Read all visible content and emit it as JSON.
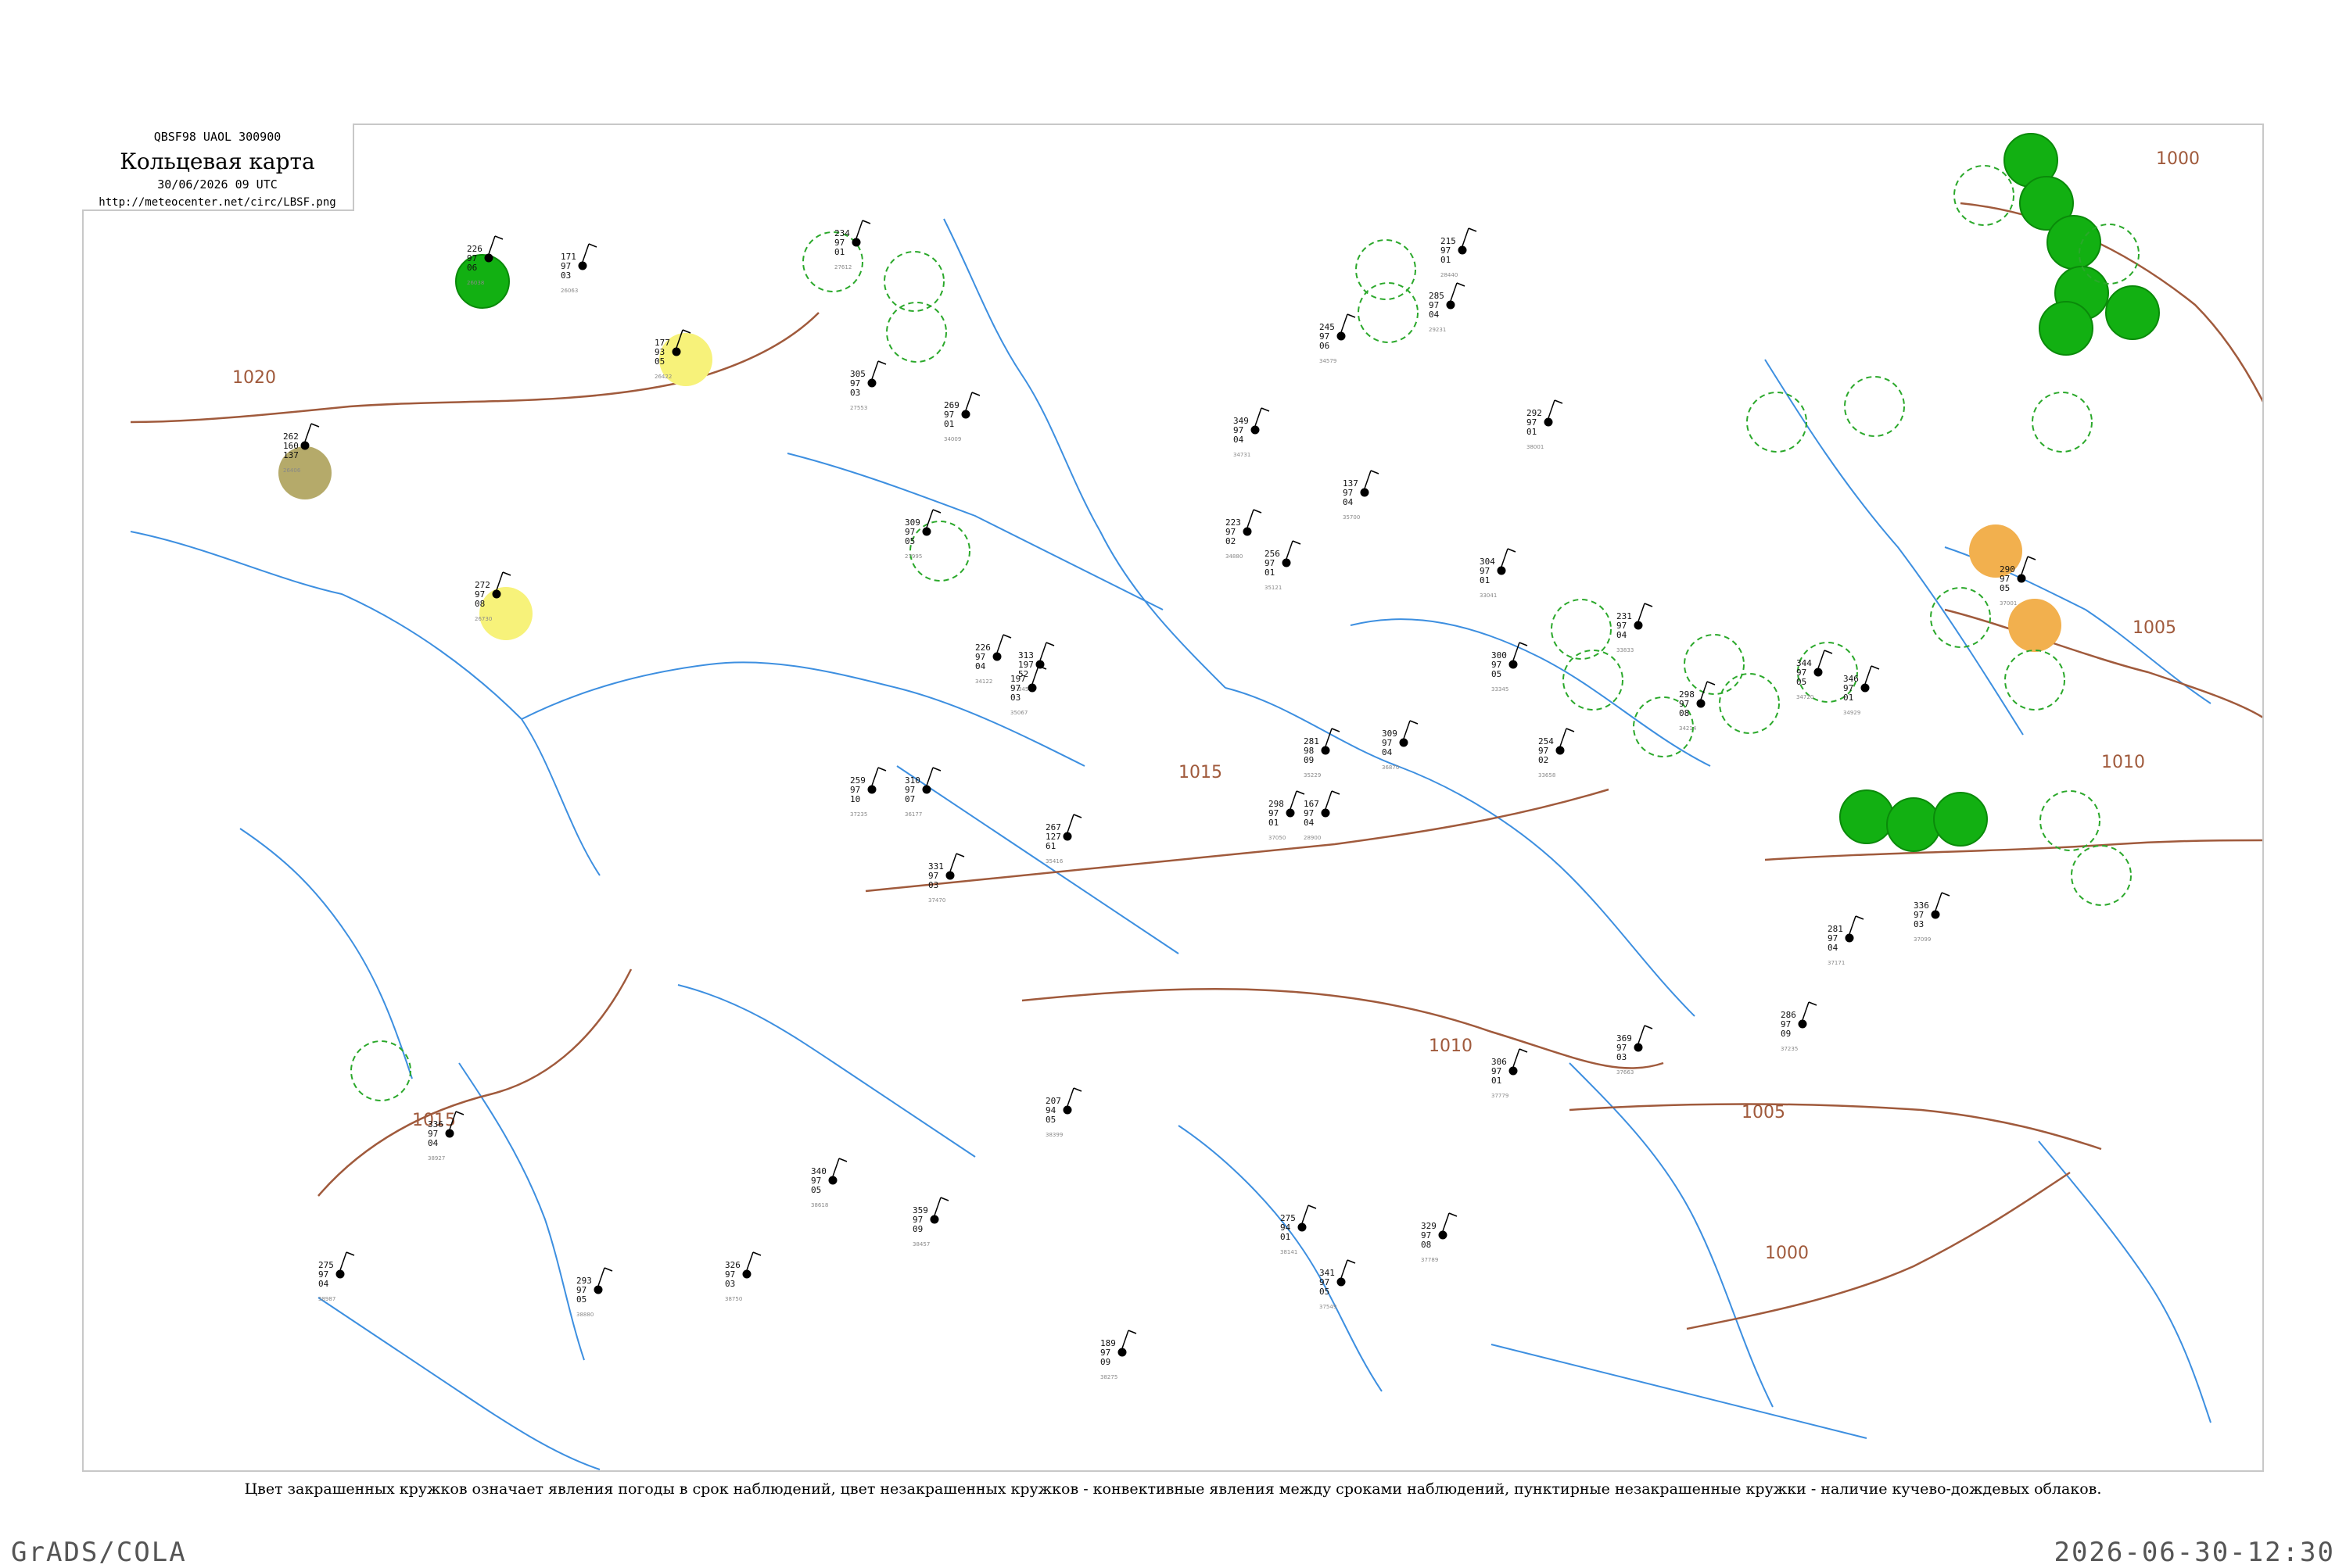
{
  "header": {
    "code": "QBSF98  UAOL  300900",
    "title": "Кольцевая карта",
    "time": "30/06/2026 09 UTC",
    "url": "http://meteocenter.net/circ/LBSF.png"
  },
  "legend_note": "Цвет закрашенных кружков означает явления погоды в срок наблюдений, цвет незакрашенных кружков - конвективные явления между сроками наблюдений, пунктирные незакрашенные кружки - наличие кучево-дождевых облаков.",
  "footer": {
    "left": "GrADS/COLA",
    "right": "2026-06-30-12:30"
  },
  "colors": {
    "isobar": "#a05a3c",
    "river": "#3d8fe0",
    "thunderstorm_fill": "#12b012",
    "cb_circle": "#2aa82a",
    "shower_fill": "#f7f27a",
    "haze_fill": "#b5aa6a",
    "dust_fill": "#f2b04e",
    "station_text": "#111111"
  },
  "isobars": [
    {
      "label": "1000",
      "id": "iso-1000-ne"
    },
    {
      "label": "1005",
      "id": "iso-1005-e"
    },
    {
      "label": "1010",
      "id": "iso-1010-e"
    },
    {
      "label": "1015",
      "id": "iso-1015-c"
    },
    {
      "label": "1020",
      "id": "iso-1020-w"
    },
    {
      "label": "1015",
      "id": "iso-1015-sw"
    },
    {
      "label": "1010",
      "id": "iso-1010-s"
    },
    {
      "label": "1005",
      "id": "iso-1005-s"
    },
    {
      "label": "1000",
      "id": "iso-1000-s"
    }
  ],
  "stations": [
    {
      "lines": [
        "226",
        "97",
        "06"
      ],
      "id": "26038"
    },
    {
      "lines": [
        "171",
        "97",
        "03"
      ],
      "id": "26063"
    },
    {
      "lines": [
        "177",
        "93",
        "05"
      ],
      "id": "26422"
    },
    {
      "lines": [
        "262",
        "160",
        "137"
      ],
      "id": "26406"
    },
    {
      "lines": [
        "272",
        "97",
        "08"
      ],
      "id": "26730"
    },
    {
      "lines": [
        "234",
        "97",
        "01"
      ],
      "id": "27612"
    },
    {
      "lines": [
        "305",
        "97",
        "03"
      ],
      "id": "27553"
    },
    {
      "lines": [
        "309",
        "97",
        "05"
      ],
      "id": "27995"
    },
    {
      "lines": [
        "215",
        "97",
        "01"
      ],
      "id": "28440"
    },
    {
      "lines": [
        "285",
        "97",
        "04"
      ],
      "id": "29231"
    },
    {
      "lines": [
        "269",
        "97",
        "01"
      ],
      "id": "34009"
    },
    {
      "lines": [
        "226",
        "97",
        "04"
      ],
      "id": "34122"
    },
    {
      "lines": [
        "313",
        "197",
        "52"
      ],
      "id": "34560"
    },
    {
      "lines": [
        "349",
        "97",
        "04"
      ],
      "id": "34731"
    },
    {
      "lines": [
        "256",
        "97",
        "01"
      ],
      "id": "35121"
    },
    {
      "lines": [
        "281",
        "98",
        "09"
      ],
      "id": "35229"
    },
    {
      "lines": [
        "267",
        "127",
        "61"
      ],
      "id": "35416"
    },
    {
      "lines": [
        "310",
        "97",
        "07"
      ],
      "id": "36177"
    },
    {
      "lines": [
        "197",
        "97",
        "03"
      ],
      "id": "35067"
    },
    {
      "lines": [
        "298",
        "97",
        "01"
      ],
      "id": "37050"
    },
    {
      "lines": [
        "259",
        "97",
        "10"
      ],
      "id": "37235"
    },
    {
      "lines": [
        "331",
        "97",
        "03"
      ],
      "id": "37470"
    },
    {
      "lines": [
        "167",
        "97",
        "04"
      ],
      "id": "28900"
    },
    {
      "lines": [
        "245",
        "97",
        "06"
      ],
      "id": "34579"
    },
    {
      "lines": [
        "223",
        "97",
        "02"
      ],
      "id": "34880"
    },
    {
      "lines": [
        "137",
        "97",
        "04"
      ],
      "id": "35700"
    },
    {
      "lines": [
        "309",
        "97",
        "04"
      ],
      "id": "36870"
    },
    {
      "lines": [
        "292",
        "97",
        "01"
      ],
      "id": "38001"
    },
    {
      "lines": [
        "304",
        "97",
        "01"
      ],
      "id": "33041"
    },
    {
      "lines": [
        "300",
        "97",
        "05"
      ],
      "id": "33345"
    },
    {
      "lines": [
        "254",
        "97",
        "02"
      ],
      "id": "33658"
    },
    {
      "lines": [
        "231",
        "97",
        "04"
      ],
      "id": "33833"
    },
    {
      "lines": [
        "298",
        "97",
        "08"
      ],
      "id": "34214"
    },
    {
      "lines": [
        "344",
        "97",
        "05"
      ],
      "id": "34720"
    },
    {
      "lines": [
        "346",
        "97",
        "01"
      ],
      "id": "34929"
    },
    {
      "lines": [
        "290",
        "97",
        "05"
      ],
      "id": "37001"
    },
    {
      "lines": [
        "336",
        "97",
        "03"
      ],
      "id": "37099"
    },
    {
      "lines": [
        "281",
        "97",
        "04"
      ],
      "id": "37171"
    },
    {
      "lines": [
        "286",
        "97",
        "09"
      ],
      "id": "37235"
    },
    {
      "lines": [
        "369",
        "97",
        "03"
      ],
      "id": "37663"
    },
    {
      "lines": [
        "306",
        "97",
        "01"
      ],
      "id": "37779"
    },
    {
      "lines": [
        "329",
        "97",
        "08"
      ],
      "id": "37789"
    },
    {
      "lines": [
        "341",
        "97",
        "05"
      ],
      "id": "37549"
    },
    {
      "lines": [
        "275",
        "94",
        "01"
      ],
      "id": "38141"
    },
    {
      "lines": [
        "189",
        "97",
        "09"
      ],
      "id": "38275"
    },
    {
      "lines": [
        "207",
        "94",
        "05"
      ],
      "id": "38399"
    },
    {
      "lines": [
        "359",
        "97",
        "09"
      ],
      "id": "38457"
    },
    {
      "lines": [
        "340",
        "97",
        "05"
      ],
      "id": "38618"
    },
    {
      "lines": [
        "326",
        "97",
        "03"
      ],
      "id": "38750"
    },
    {
      "lines": [
        "293",
        "97",
        "05"
      ],
      "id": "38880"
    },
    {
      "lines": [
        "336",
        "97",
        "04"
      ],
      "id": "38927"
    },
    {
      "lines": [
        "275",
        "97",
        "04"
      ],
      "id": "38987"
    }
  ]
}
